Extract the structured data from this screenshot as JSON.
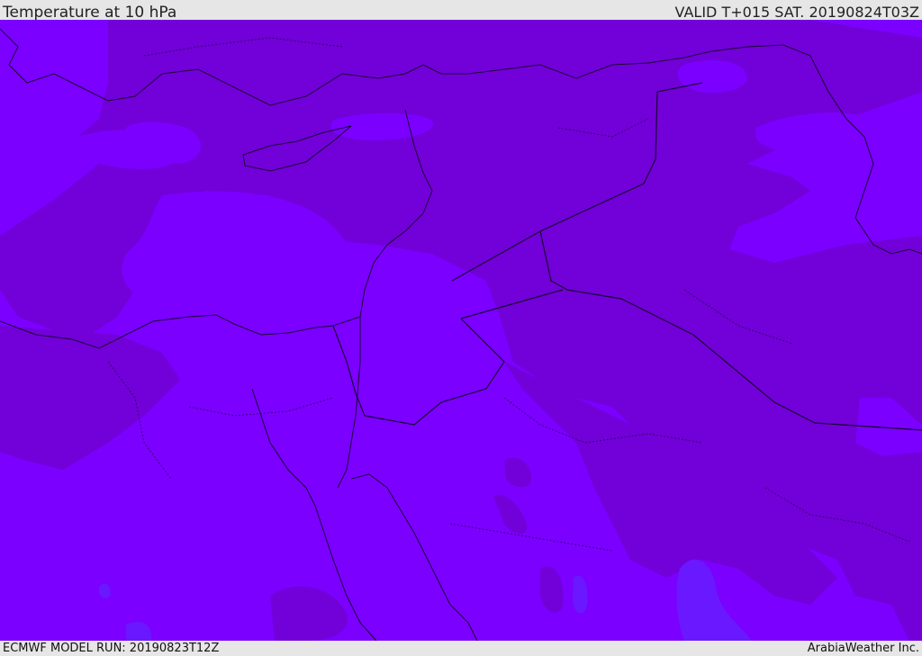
{
  "header": {
    "title": "Temperature at 10 hPa",
    "valid": "VALID T+015 SAT. 20190824T03Z"
  },
  "footer": {
    "model_run": "ECMWF MODEL RUN: 20190823T12Z",
    "credit": "ArabiaWeather Inc."
  },
  "colors": {
    "field_light": "#7b00ff",
    "field_dark": "#7200d8",
    "field_blue": "#6a18ff",
    "border": "#1a0033"
  }
}
